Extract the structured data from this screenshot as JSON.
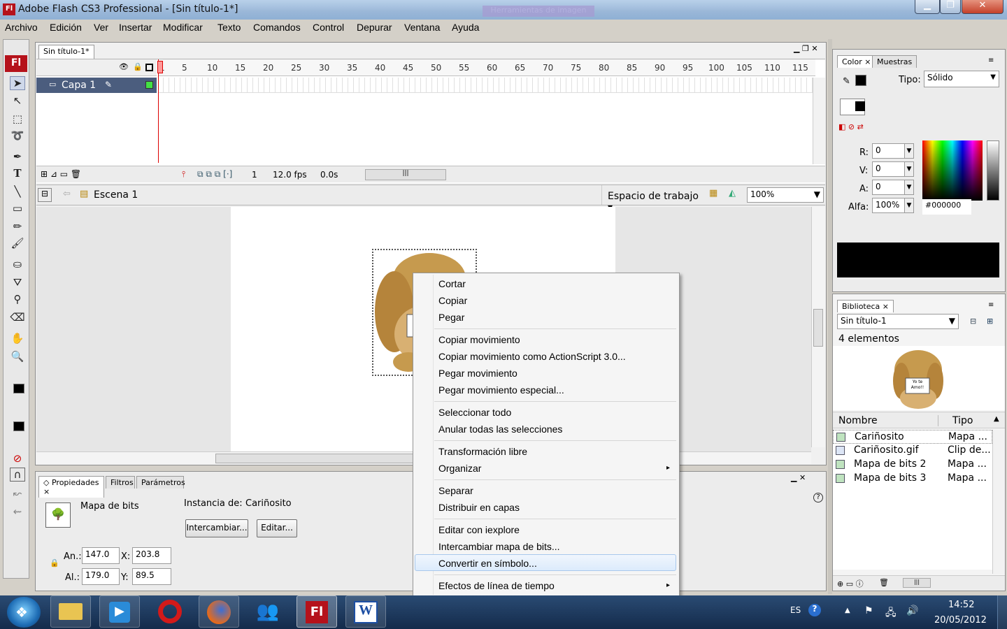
{
  "window": {
    "title": "Adobe Flash CS3 Professional - [Sin título-1*]",
    "app_logo": "Fl",
    "faded_text": "Herramientas de imagen"
  },
  "menu": [
    "Archivo",
    "Edición",
    "Ver",
    "Insertar",
    "Modificar",
    "Texto",
    "Comandos",
    "Control",
    "Depurar",
    "Ventana",
    "Ayuda"
  ],
  "document_tab": "Sin título-1*",
  "timeline": {
    "frame_numbers": [
      "1",
      "5",
      "10",
      "15",
      "20",
      "25",
      "30",
      "35",
      "40",
      "45",
      "50",
      "55",
      "60",
      "65",
      "70",
      "75",
      "80",
      "85",
      "90",
      "95",
      "100",
      "105",
      "110",
      "115"
    ],
    "layer_name": "Capa 1",
    "current_frame": "1",
    "fps": "12.0 fps",
    "time": "0.0s"
  },
  "edit_bar": {
    "scene": "Escena 1",
    "workspace": "Espacio de trabajo",
    "zoom": "100%"
  },
  "context_menu": {
    "groups": [
      [
        "Cortar",
        "Copiar",
        "Pegar"
      ],
      [
        "Copiar movimiento",
        "Copiar movimiento como ActionScript 3.0...",
        "Pegar movimiento",
        "Pegar movimiento especial..."
      ],
      [
        "Seleccionar todo",
        "Anular todas las selecciones"
      ],
      [
        "Transformación libre",
        "Organizar"
      ],
      [
        "Separar",
        "Distribuir en capas"
      ],
      [
        "Editar con iexplore",
        "Intercambiar mapa de bits...",
        "Convertir en símbolo..."
      ],
      [
        "Efectos de línea de tiempo"
      ]
    ],
    "highlighted": "Convertir en símbolo..."
  },
  "properties": {
    "tabs": [
      "Propiedades",
      "Filtros",
      "Parámetros"
    ],
    "type": "Mapa de bits",
    "instance_label": "Instancia de:",
    "instance_value": "Cariñosito",
    "swap_button": "Intercambiar...",
    "edit_button": "Editar...",
    "w_label": "An.:",
    "w_value": "147.0",
    "h_label": "Al.:",
    "h_value": "179.0",
    "x_label": "X:",
    "x_value": "203.8",
    "y_label": "Y:",
    "y_value": "89.5"
  },
  "color_panel": {
    "tabs": [
      "Color",
      "Muestras"
    ],
    "type_label": "Tipo:",
    "type_value": "Sólido",
    "r_label": "R:",
    "r_value": "0",
    "g_label": "V:",
    "g_value": "0",
    "b_label": "A:",
    "b_value": "0",
    "alpha_label": "Alfa:",
    "alpha_value": "100%",
    "hex": "#000000",
    "swatch_color": "#000000"
  },
  "library": {
    "tab": "Biblioteca",
    "document": "Sin título-1",
    "count": "4 elementos",
    "preview_text": "Yo te Amo!!",
    "col_name": "Nombre",
    "col_type": "Tipo",
    "items": [
      {
        "name": "Cariñosito",
        "type": "Mapa ..."
      },
      {
        "name": "Cariñosito.gif",
        "type": "Clip de..."
      },
      {
        "name": "Mapa de bits 2",
        "type": "Mapa ..."
      },
      {
        "name": "Mapa de bits 3",
        "type": "Mapa ..."
      }
    ]
  },
  "taskbar": {
    "lang": "ES",
    "time": "14:52",
    "date": "20/05/2012"
  },
  "colors": {
    "accent": "#b5121b",
    "stage": "#ffffff",
    "panel": "#ececec"
  }
}
